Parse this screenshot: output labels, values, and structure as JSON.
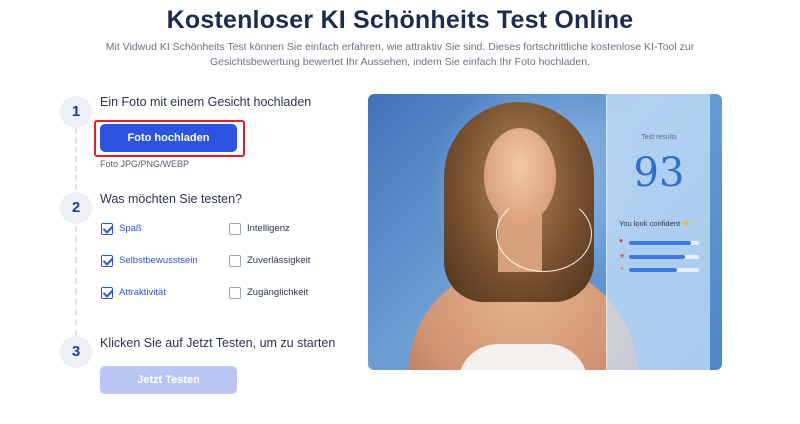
{
  "header": {
    "title": "Kostenloser KI Schönheits Test Online",
    "subtitle": "Mit Vidwud KI Schönheits Test können Sie einfach erfahren, wie attraktiv Sie sind. Dieses fortschrittliche kostenlose KI-Tool zur Gesichtsbewertung bewertet Ihr Aussehen, indem Sie einfach Ihr Foto hochladen."
  },
  "steps": [
    {
      "number": "1",
      "title": "Ein Foto mit einem Gesicht hochladen"
    },
    {
      "number": "2",
      "title": "Was möchten Sie testen?"
    },
    {
      "number": "3",
      "title": "Klicken Sie auf Jetzt Testen, um zu starten"
    }
  ],
  "upload": {
    "button_label": "Foto hochladen",
    "formats": "Foto JPG/PNG/WEBP"
  },
  "options": [
    {
      "label": "Spaß",
      "checked": true
    },
    {
      "label": "Intelligenz",
      "checked": false
    },
    {
      "label": "Selbstbewusstsein",
      "checked": true
    },
    {
      "label": "Zuverlässigkeit",
      "checked": false
    },
    {
      "label": "Attraktivität",
      "checked": true
    },
    {
      "label": "Zugänglichkeit",
      "checked": false
    }
  ],
  "test_button_label": "Jetzt Testen",
  "preview": {
    "results_label": "Test results",
    "score": "93",
    "confident_text": "You look confident",
    "star_icon": "star-icon",
    "bars": [
      {
        "icon": "heart-icon",
        "glyph": "♥",
        "color": "#e0394a",
        "fill": 0.88
      },
      {
        "icon": "star-small-icon",
        "glyph": "★",
        "color": "#e05a5a",
        "fill": 0.8
      },
      {
        "icon": "badge-icon",
        "glyph": "✦",
        "color": "#e08a8a",
        "fill": 0.68
      }
    ]
  },
  "colors": {
    "accent": "#2c54e0",
    "highlight": "#e3202a",
    "disabled": "#b9c5f4"
  }
}
